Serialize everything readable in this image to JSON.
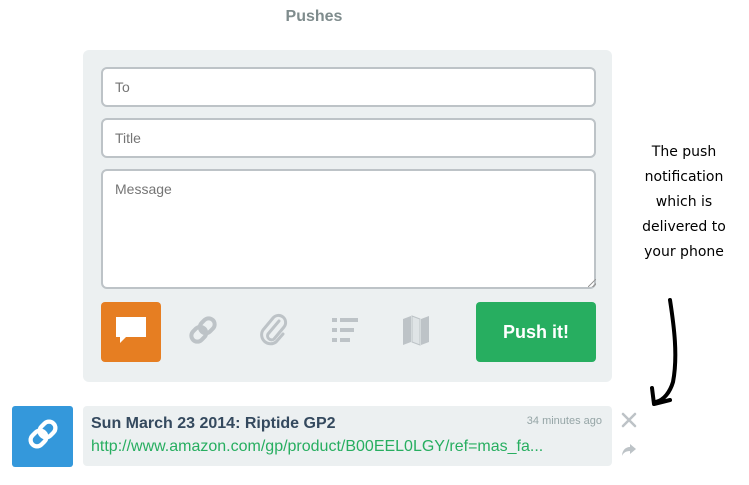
{
  "page": {
    "title": "Pushes"
  },
  "composer": {
    "to_placeholder": "To",
    "title_placeholder": "Title",
    "message_placeholder": "Message",
    "types": [
      {
        "icon": "note-icon",
        "active": true
      },
      {
        "icon": "link-icon",
        "active": false
      },
      {
        "icon": "paperclip-icon",
        "active": false
      },
      {
        "icon": "list-icon",
        "active": false
      },
      {
        "icon": "map-icon",
        "active": false
      }
    ],
    "push_label": "Push it!"
  },
  "annotation": {
    "lines": [
      "The push",
      "notification",
      "which is",
      "delivered to",
      "your phone"
    ]
  },
  "push_item": {
    "icon": "link-icon",
    "title": "Sun March 23 2014: Riptide GP2",
    "time": "34 minutes ago",
    "link": "http://www.amazon.com/gp/product/B00EEL0LGY/ref=mas_fa..."
  },
  "colors": {
    "accent_orange": "#e67e22",
    "push_green": "#27ae60",
    "link_blue": "#3498db",
    "panel_bg": "#ecf0f1"
  }
}
